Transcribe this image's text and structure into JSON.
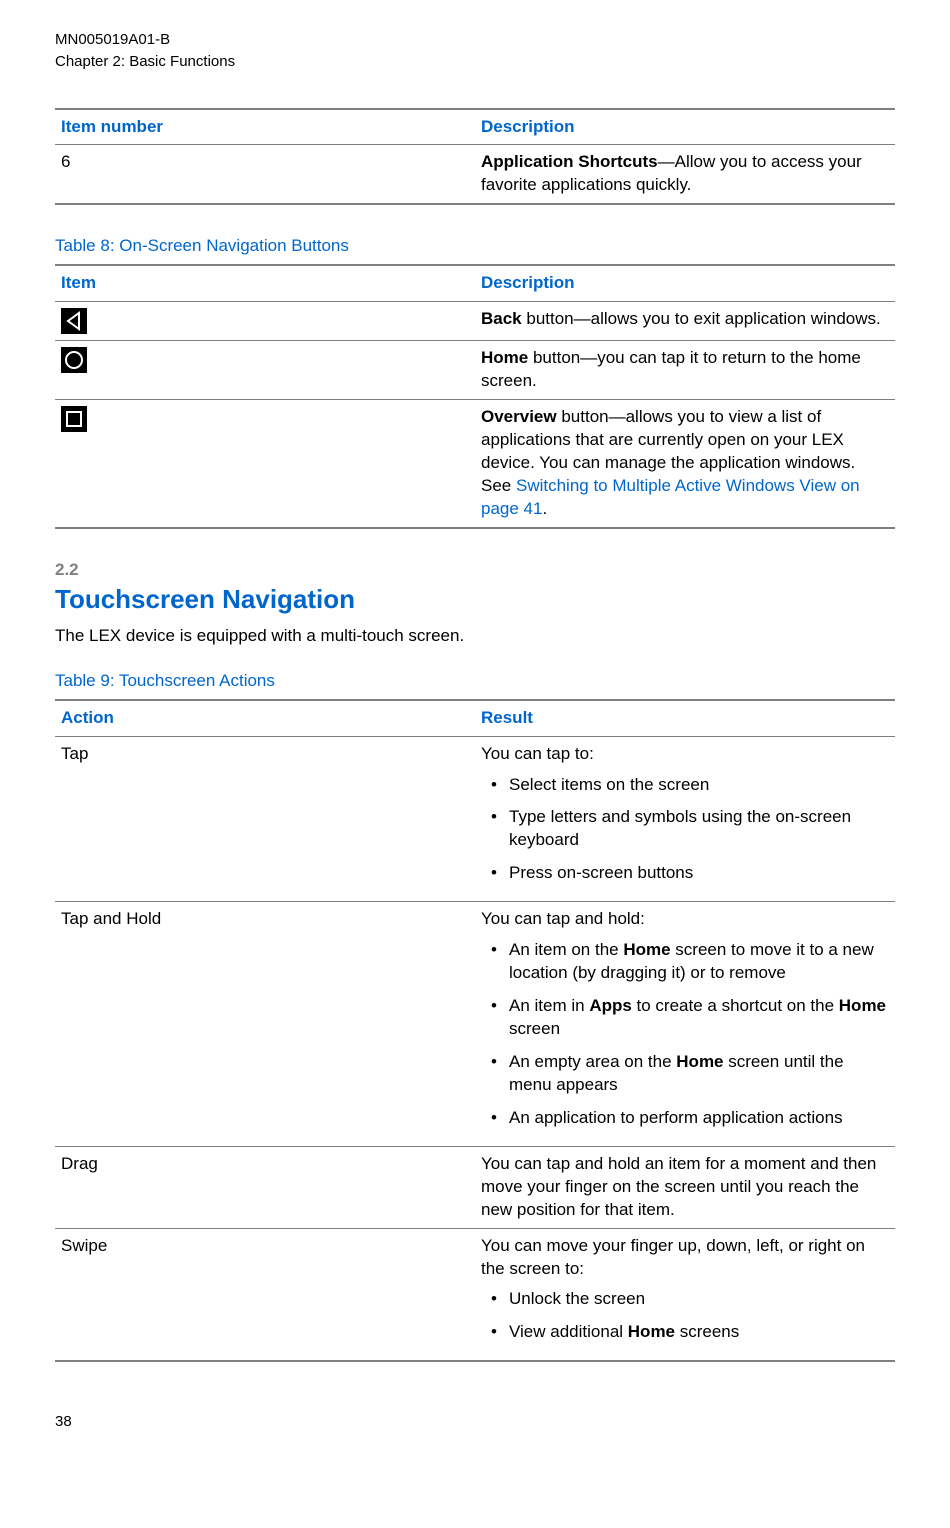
{
  "header": {
    "doc_id": "MN005019A01-B",
    "chapter": "Chapter 2:  Basic Functions"
  },
  "table7": {
    "headers": {
      "col1": "Item number",
      "col2": "Description"
    },
    "row": {
      "item": "6",
      "desc_bold": "Application Shortcuts",
      "desc_rest": "—Allow you to access your favorite applications quickly."
    }
  },
  "table8": {
    "caption": "Table 8: On-Screen Navigation Buttons",
    "headers": {
      "col1": "Item",
      "col2": "Description"
    },
    "rows": [
      {
        "icon": "back",
        "bold": "Back",
        "rest": " button—allows you to exit application windows."
      },
      {
        "icon": "home",
        "bold": "Home",
        "rest": " button—you can tap it to return to the home screen."
      },
      {
        "icon": "overview",
        "bold": "Overview",
        "rest_pre": " button—allows you to view a list of applications that are currently open on your LEX device. You can manage the application windows. See ",
        "link": "Switching to Multiple Active Windows View on page 41",
        "rest_post": "."
      }
    ]
  },
  "section": {
    "num": "2.2",
    "title": "Touchscreen Navigation",
    "body": "The LEX device is equipped with a multi-touch screen."
  },
  "table9": {
    "caption": "Table 9: Touchscreen Actions",
    "headers": {
      "col1": "Action",
      "col2": "Result"
    },
    "rows": {
      "tap": {
        "action": "Tap",
        "intro": "You can tap to:",
        "items": [
          {
            "text": "Select items on the screen"
          },
          {
            "text": "Type letters and symbols using the on-screen keyboard"
          },
          {
            "text": "Press on-screen buttons"
          }
        ]
      },
      "taphold": {
        "action": "Tap and Hold",
        "intro": "You can tap and hold:",
        "items": [
          {
            "pre": "An item on the ",
            "b1": "Home",
            "post": " screen to move it to a new location (by dragging it) or to remove"
          },
          {
            "pre": "An item in ",
            "b1": "Apps",
            "mid": " to create a shortcut on the ",
            "b2": "Home",
            "post": " screen"
          },
          {
            "pre": "An empty area on the ",
            "b1": "Home",
            "post": " screen until the menu appears"
          },
          {
            "text": "An application to perform application actions"
          }
        ]
      },
      "drag": {
        "action": "Drag",
        "text": "You can tap and hold an item for a moment and then move your finger on the screen until you reach the new position for that item."
      },
      "swipe": {
        "action": "Swipe",
        "intro": "You can move your finger up, down, left, or right on the screen to:",
        "items": [
          {
            "text": "Unlock the screen"
          },
          {
            "pre": "View additional ",
            "b1": "Home",
            "post": " screens"
          }
        ]
      }
    }
  },
  "page_num": "38"
}
